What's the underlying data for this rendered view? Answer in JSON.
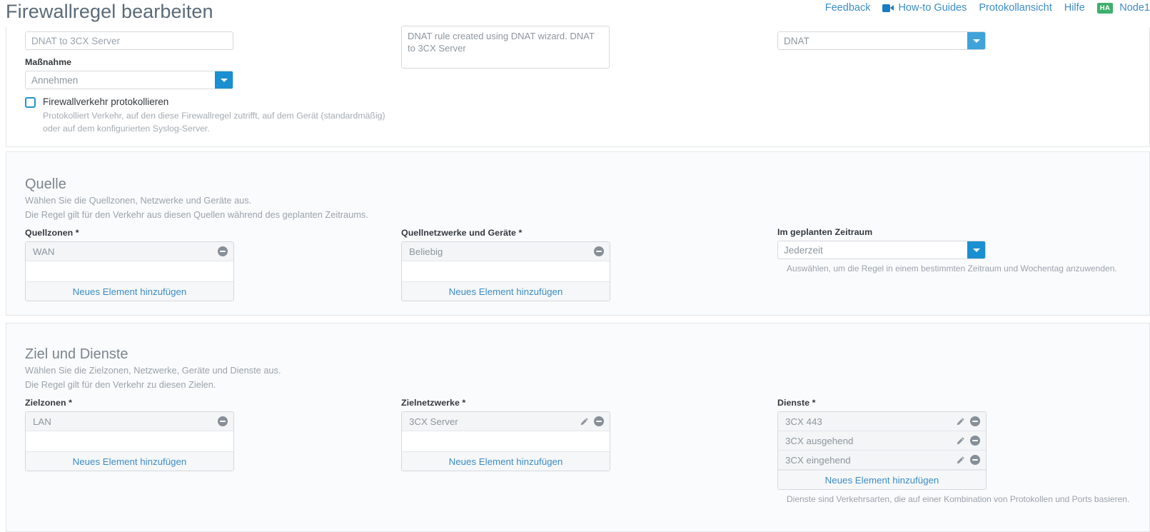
{
  "header": {
    "title": "Firewallregel bearbeiten",
    "nav": [
      {
        "label": "Feedback",
        "icon": null
      },
      {
        "label": "How-to Guides",
        "icon": "video-camera-icon"
      },
      {
        "label": "Protokollansicht",
        "icon": null
      },
      {
        "label": "Hilfe",
        "icon": null
      }
    ],
    "node": {
      "badge": "HA",
      "label": "Node1"
    }
  },
  "colors": {
    "accent_blue": "#1a8fd1",
    "link_blue": "#3d8dc4",
    "ha_green": "#3faf6c",
    "heading_grey": "#7b858e"
  },
  "rule_basics": {
    "name_value": "DNAT to 3CX Server",
    "description_value": "DNAT rule created using DNAT wizard. DNAT to 3CX Server",
    "type_value": "DNAT",
    "action_label": "Maßnahme",
    "action_value": "Annehmen",
    "log_checkbox": {
      "label": "Firewallverkehr protokollieren",
      "checked": false,
      "hint": "Protokolliert Verkehr, auf den diese Firewallregel zutrifft, auf dem Gerät (standardmäßig) oder auf dem konfigurierten Syslog-Server."
    }
  },
  "source_section": {
    "title": "Quelle",
    "desc_line1": "Wählen Sie die Quellzonen, Netzwerke und Geräte aus.",
    "desc_line2": "Die Regel gilt für den Verkehr aus diesen Quellen während des geplanten Zeitraums.",
    "source_zones": {
      "label": "Quellzonen *",
      "items": [
        {
          "name": "WAN",
          "editable": false
        }
      ],
      "add_label": "Neues Element hinzufügen"
    },
    "source_networks": {
      "label": "Quellnetzwerke und Geräte *",
      "items": [
        {
          "name": "Beliebig",
          "editable": false
        }
      ],
      "add_label": "Neues Element hinzufügen"
    },
    "schedule": {
      "label": "Im geplanten Zeitraum",
      "value": "Jederzeit",
      "hint": "Auswählen, um die Regel in einem bestimmten Zeitraum und Wochentag anzuwenden."
    }
  },
  "destination_section": {
    "title": "Ziel und Dienste",
    "desc_line1": "Wählen Sie die Zielzonen, Netzwerke, Geräte und Dienste aus.",
    "desc_line2": "Die Regel gilt für den Verkehr zu diesen Zielen.",
    "dest_zones": {
      "label": "Zielzonen *",
      "items": [
        {
          "name": "LAN",
          "editable": false
        }
      ],
      "add_label": "Neues Element hinzufügen"
    },
    "dest_networks": {
      "label": "Zielnetzwerke *",
      "items": [
        {
          "name": "3CX Server",
          "editable": true
        }
      ],
      "add_label": "Neues Element hinzufügen"
    },
    "services": {
      "label": "Dienste *",
      "items": [
        {
          "name": "3CX 443",
          "editable": true
        },
        {
          "name": "3CX ausgehend",
          "editable": true
        },
        {
          "name": "3CX eingehend",
          "editable": true
        }
      ],
      "add_label": "Neues Element hinzufügen",
      "hint": "Dienste sind Verkehrsarten, die auf einer Kombination von Protokollen und Ports basieren."
    }
  }
}
